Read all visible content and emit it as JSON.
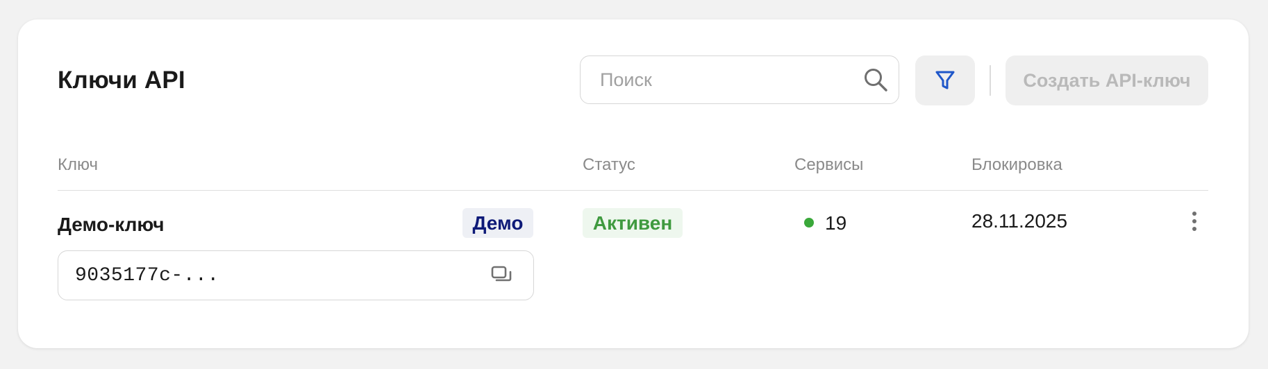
{
  "page": {
    "title": "Ключи API"
  },
  "toolbar": {
    "search_placeholder": "Поиск",
    "search_icon": "search-icon",
    "filter_icon": "filter-icon",
    "create_label": "Создать API-ключ"
  },
  "table": {
    "columns": [
      "Ключ",
      "Статус",
      "Сервисы",
      "Блокировка"
    ],
    "rows": [
      {
        "name": "Демо-ключ",
        "badge": "Демо",
        "key_value": "9035177c-...",
        "status": "Активен",
        "services_count": "19",
        "block_date": "28.11.2025"
      }
    ]
  },
  "colors": {
    "accent_blue": "#1f57c9",
    "status_green": "#3f9a3f",
    "service_dot_green": "#3aa83a",
    "demo_badge_text": "#0e1a78",
    "disabled_text": "#b9b9b9"
  }
}
